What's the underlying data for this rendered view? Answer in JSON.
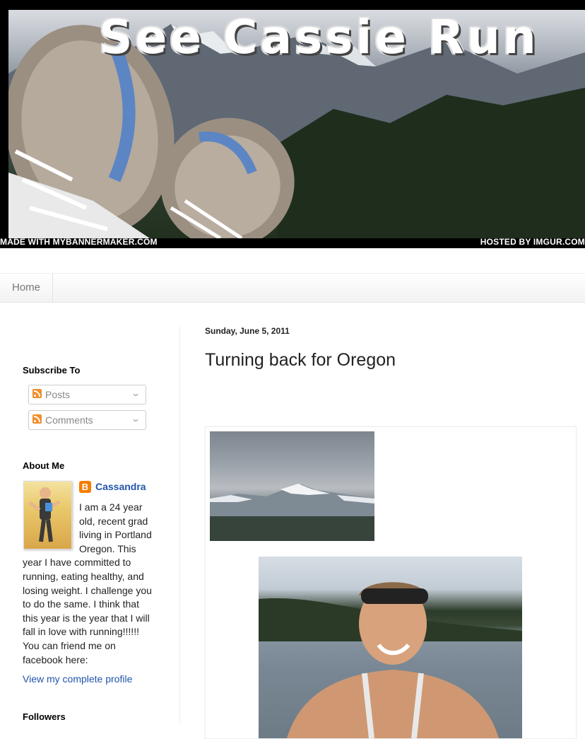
{
  "banner": {
    "title": "See Cassie Run",
    "credit_left": "MADE WITH MYBANNERMAKER.COM",
    "credit_right": "HOSTED BY IMGUR.COM"
  },
  "nav": {
    "tabs": [
      {
        "label": "Home"
      }
    ]
  },
  "sidebar": {
    "subscribe": {
      "heading": "Subscribe To",
      "items": [
        {
          "label": "Posts"
        },
        {
          "label": "Comments"
        }
      ]
    },
    "about": {
      "heading": "About Me",
      "name": "Cassandra",
      "text": "I am a 24 year old, recent grad living in Portland Oregon. This year I have committed to running, eating healthy, and losing weight. I challenge you to do the same. I think that this year is the year that I will fall in love with running!!!!!! You can friend me on facebook here:",
      "profile_link": "View my complete profile"
    },
    "followers": {
      "heading": "Followers"
    }
  },
  "post": {
    "date": "Sunday, June 5, 2011",
    "title": "Turning back for Oregon"
  },
  "colors": {
    "link": "#2255aa",
    "feed": "#f28e2b",
    "blogger": "#f57d00"
  }
}
